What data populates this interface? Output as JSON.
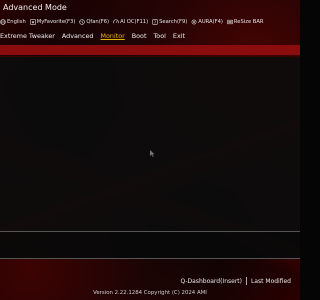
{
  "header": {
    "title": "Advanced Mode"
  },
  "hotkeys": [
    {
      "label": "English",
      "icon": "globe-icon"
    },
    {
      "label": "MyFavorite(F3)",
      "icon": "star-icon"
    },
    {
      "label": "Qfan(F6)",
      "icon": "fan-icon"
    },
    {
      "label": "AI OC(F11)",
      "icon": "gauge-icon"
    },
    {
      "label": "Search(F9)",
      "icon": "question-icon"
    },
    {
      "label": "AURA(F4)",
      "icon": "aura-icon"
    },
    {
      "label": "ReSize BAR",
      "icon": "resize-bar-icon"
    }
  ],
  "menu": {
    "items": [
      "Extreme Tweaker",
      "Advanced",
      "Monitor",
      "Boot",
      "Tool",
      "Exit"
    ],
    "active": "Monitor"
  },
  "footer": {
    "qdashboard": "Q-Dashboard(Insert)",
    "last_modified": "Last Modified",
    "version": "Version 2.22.1284 Copyright (C) 2024 AMI"
  },
  "colors": {
    "accent": "#e8b100",
    "red_bar": "#8a0c0c",
    "background": "#050505"
  }
}
